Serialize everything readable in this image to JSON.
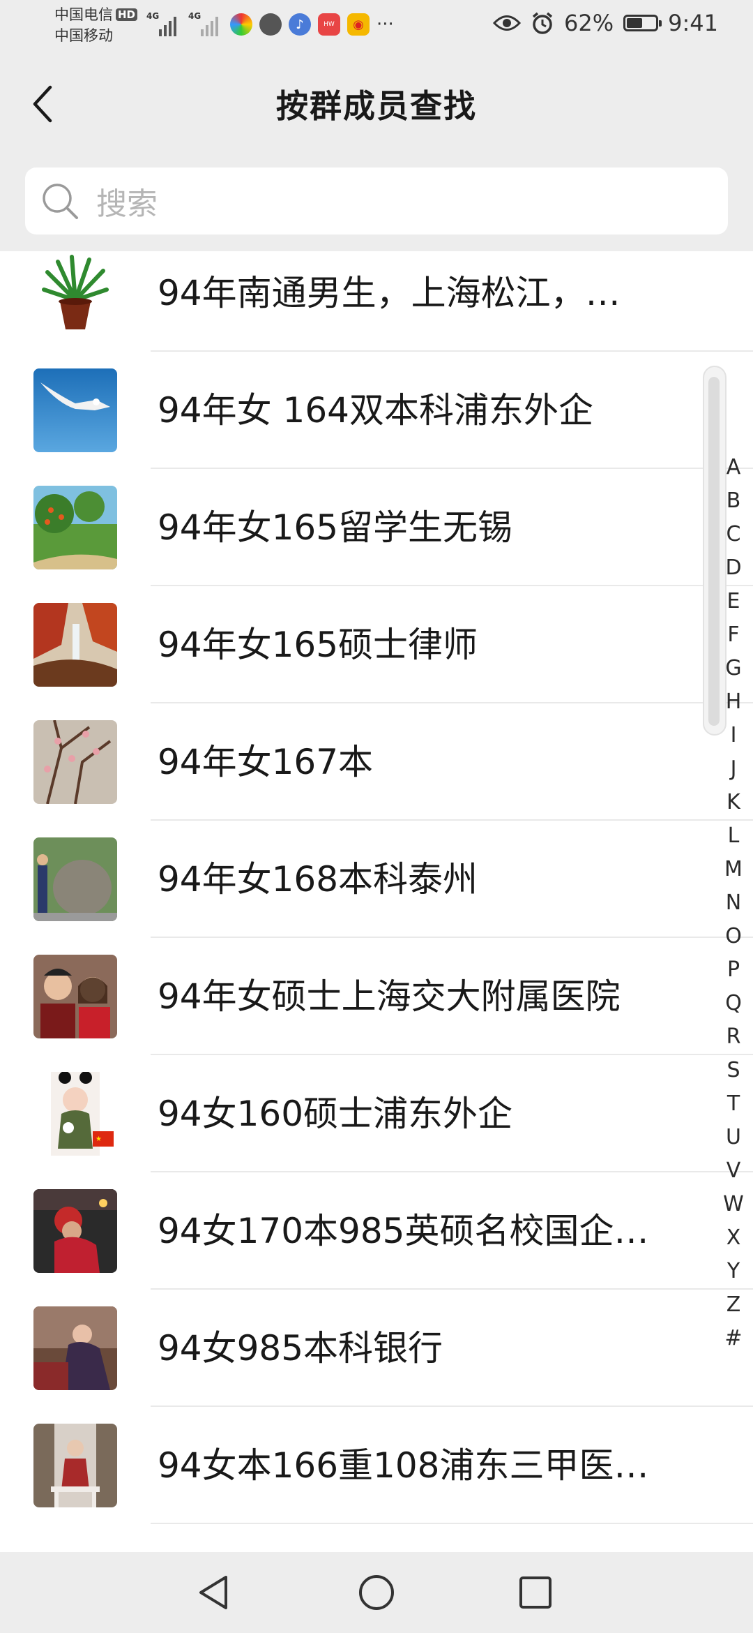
{
  "status_bar": {
    "carrier1": "中国电信",
    "hd": "HD",
    "carrier2": "中国移动",
    "network1": "4G",
    "network2": "4G",
    "more": "···",
    "battery_percent": "62%",
    "battery_level": 0.62,
    "time": "9:41"
  },
  "header": {
    "title": "按群成员查找"
  },
  "search": {
    "placeholder": "搜索"
  },
  "members": [
    {
      "name": "94年南通男生，上海松江，…"
    },
    {
      "name": "94年女 164双本科浦东外企"
    },
    {
      "name": "94年女165留学生无锡"
    },
    {
      "name": "94年女165硕士律师"
    },
    {
      "name": "94年女167本"
    },
    {
      "name": "94年女168本科泰州"
    },
    {
      "name": "94年女硕士上海交大附属医院"
    },
    {
      "name": "94女160硕士浦东外企"
    },
    {
      "name": "94女170本985英硕名校国企…"
    },
    {
      "name": "94女985本科银行"
    },
    {
      "name": "94女本166重108浦东三甲医…"
    }
  ],
  "index_letters": [
    "A",
    "B",
    "C",
    "D",
    "E",
    "F",
    "G",
    "H",
    "I",
    "J",
    "K",
    "L",
    "M",
    "N",
    "O",
    "P",
    "Q",
    "R",
    "S",
    "T",
    "U",
    "V",
    "W",
    "X",
    "Y",
    "Z",
    "#"
  ]
}
